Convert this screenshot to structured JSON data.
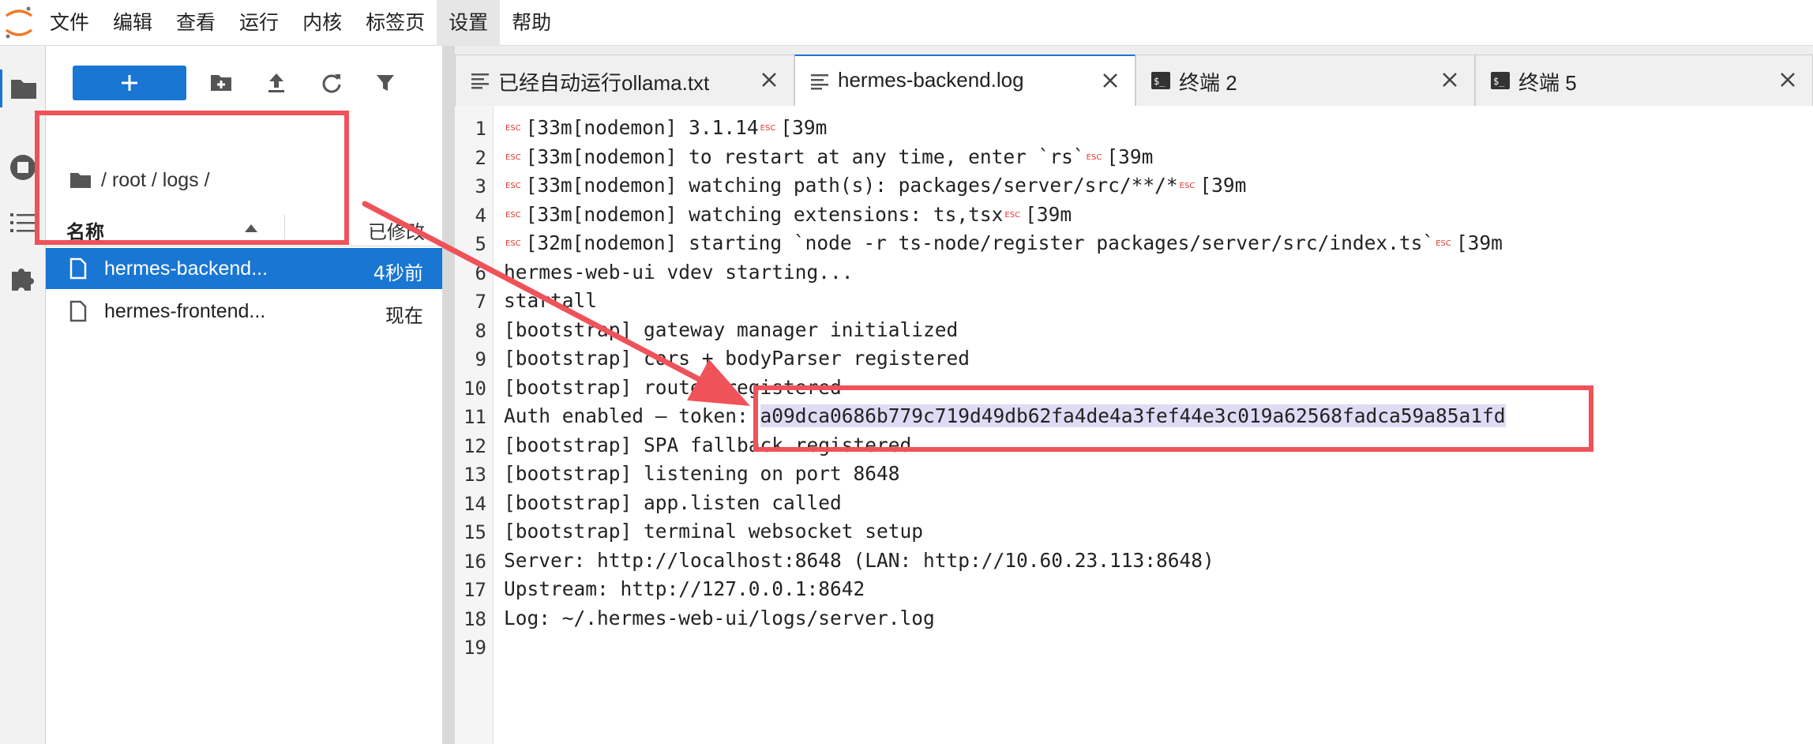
{
  "menu": {
    "items": [
      "文件",
      "编辑",
      "查看",
      "运行",
      "内核",
      "标签页",
      "设置",
      "帮助"
    ],
    "active_index": 6
  },
  "icons": {
    "app_logo": "jupyter-logo-icon",
    "activity": [
      "folder-icon",
      "stop-circle-icon",
      "list-icon",
      "puzzle-icon"
    ],
    "toolbar": [
      "plus-icon",
      "new-folder-icon",
      "upload-icon",
      "refresh-icon",
      "filter-icon"
    ],
    "file": "file-icon",
    "tab_text": "text-file-icon",
    "tab_terminal": "terminal-icon",
    "close": "close-icon"
  },
  "colors": {
    "accent": "#1976d2",
    "annotation": "#f0525a",
    "highlight": "#e0dbf5",
    "esc": "#e53935"
  },
  "file_browser": {
    "breadcrumb": "/ root / logs /",
    "columns": {
      "name": "名称",
      "modified": "已修改"
    },
    "files": [
      {
        "name": "hermes-backend...",
        "modified": "4秒前",
        "selected": true
      },
      {
        "name": "hermes-frontend...",
        "modified": "现在",
        "selected": false
      }
    ]
  },
  "tabs": [
    {
      "label": "已经自动运行ollama.txt",
      "icon": "text-file-icon",
      "active": false
    },
    {
      "label": "hermes-backend.log",
      "icon": "text-file-icon",
      "active": true
    },
    {
      "label": "终端 2",
      "icon": "terminal-icon",
      "active": false
    },
    {
      "label": "终端 5",
      "icon": "terminal-icon",
      "active": false
    }
  ],
  "editor": {
    "esc_glyph": "ESC",
    "lines": [
      {
        "n": "1",
        "esc_prefix": true,
        "text": "[33m[nodemon] 3.1.14",
        "esc_suffix": true,
        "suffix": "[39m"
      },
      {
        "n": "2",
        "esc_prefix": true,
        "text": "[33m[nodemon] to restart at any time, enter `rs`",
        "esc_suffix": true,
        "suffix": "[39m"
      },
      {
        "n": "3",
        "esc_prefix": true,
        "text": "[33m[nodemon] watching path(s): packages/server/src/**/*",
        "esc_suffix": true,
        "suffix": "[39m"
      },
      {
        "n": "4",
        "esc_prefix": true,
        "text": "[33m[nodemon] watching extensions: ts,tsx",
        "esc_suffix": true,
        "suffix": "[39m"
      },
      {
        "n": "5",
        "esc_prefix": true,
        "text": "[32m[nodemon] starting `node -r ts-node/register packages/server/src/index.ts`",
        "esc_suffix": true,
        "suffix": "[39m"
      },
      {
        "n": "6",
        "text": "hermes-web-ui vdev starting..."
      },
      {
        "n": "7",
        "text": "startall"
      },
      {
        "n": "8",
        "text": "[bootstrap] gateway manager initialized"
      },
      {
        "n": "9",
        "text": "[bootstrap] cors + bodyParser registered"
      },
      {
        "n": "10",
        "text": "[bootstrap] routes registered"
      },
      {
        "n": "11",
        "text": "Auth enabled — token: ",
        "highlight": "a09dca0686b779c719d49db62fa4de4a3fef44e3c019a62568fadca59a85a1fd"
      },
      {
        "n": "12",
        "text": "[bootstrap] SPA fallback registered"
      },
      {
        "n": "13",
        "text": "[bootstrap] listening on port 8648"
      },
      {
        "n": "14",
        "text": "[bootstrap] app.listen called"
      },
      {
        "n": "15",
        "text": "[bootstrap] terminal websocket setup"
      },
      {
        "n": "16",
        "text": "Server: http://localhost:8648 (LAN: http://10.60.23.113:8648)"
      },
      {
        "n": "17",
        "text": "Upstream: http://127.0.0.1:8642"
      },
      {
        "n": "18",
        "text": "Log: ~/.hermes-web-ui/logs/server.log"
      },
      {
        "n": "19",
        "text": ""
      }
    ]
  }
}
